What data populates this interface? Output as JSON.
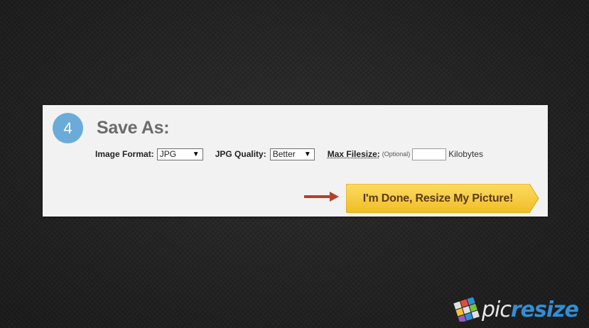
{
  "step": {
    "number": "4",
    "title": "Save As:"
  },
  "form": {
    "image_format_label": "Image Format:",
    "image_format_value": "JPG",
    "jpg_quality_label": "JPG Quality:",
    "jpg_quality_value": "Better",
    "max_filesize_label": "Max Filesize:",
    "optional_label": "(Optional)",
    "max_filesize_value": "",
    "unit_label": "Kilobytes"
  },
  "cta": {
    "label": "I'm Done, Resize My Picture!"
  },
  "logo": {
    "pic": "pic",
    "resize": "resize"
  },
  "colors": {
    "step_circle": "#6aabd9",
    "cta_fill": "#f6c93c",
    "cta_text": "#5a3a15",
    "arrow": "#b5412a",
    "logo_pic": "#e8e8e8",
    "logo_resize": "#2f8fd6"
  },
  "icons": {
    "dropdown_arrow": "triangle-down-icon",
    "pointer_arrow": "arrow-right-icon",
    "logo": "picresize-logo-icon"
  }
}
